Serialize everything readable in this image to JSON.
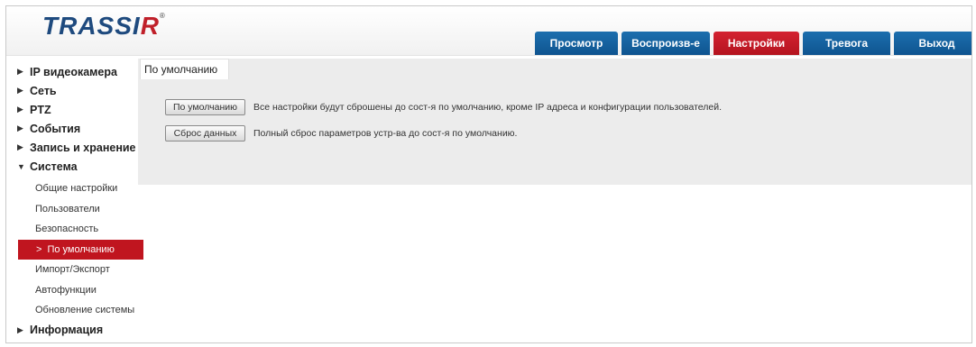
{
  "brand": {
    "logo_main": "TRASSI",
    "logo_accent": "R",
    "logo_reg": "®"
  },
  "top_tabs": [
    {
      "label": "Просмотр",
      "active": false
    },
    {
      "label": "Воспроизв-е",
      "active": false
    },
    {
      "label": "Настройки",
      "active": true
    },
    {
      "label": "Тревога",
      "active": false
    },
    {
      "label": "Выход",
      "active": false
    }
  ],
  "sidebar": {
    "groups": [
      {
        "label": "IP видеокамера",
        "arrow": "▶"
      },
      {
        "label": "Сеть",
        "arrow": "▶"
      },
      {
        "label": "PTZ",
        "arrow": "▶"
      },
      {
        "label": "События",
        "arrow": "▶"
      },
      {
        "label": "Запись и хранение",
        "arrow": "▶"
      },
      {
        "label": "Система",
        "arrow": "▼"
      }
    ],
    "system_items": [
      {
        "label": "Общие настройки"
      },
      {
        "label": "Пользователи"
      },
      {
        "label": "Безопасность"
      },
      {
        "label": "По умолчанию",
        "active": true,
        "chevron": ">"
      },
      {
        "label": "Импорт/Экспорт"
      },
      {
        "label": "Автофункции"
      },
      {
        "label": "Обновление системы"
      }
    ],
    "last_group": {
      "label": "Информация",
      "arrow": "▶"
    }
  },
  "main": {
    "tab_label": "По умолчанию",
    "actions": [
      {
        "button": "По умолчанию",
        "description": "Все настройки будут сброшены до сост-я по умолчанию, кроме IP адреса и конфигурации пользователей."
      },
      {
        "button": "Сброс данных",
        "description": "Полный сброс параметров устр-ва до сост-я по умолчанию."
      }
    ]
  },
  "colors": {
    "accent_red": "#c0151f",
    "tab_blue": "#0f5490",
    "panel_bg": "#ececec"
  }
}
